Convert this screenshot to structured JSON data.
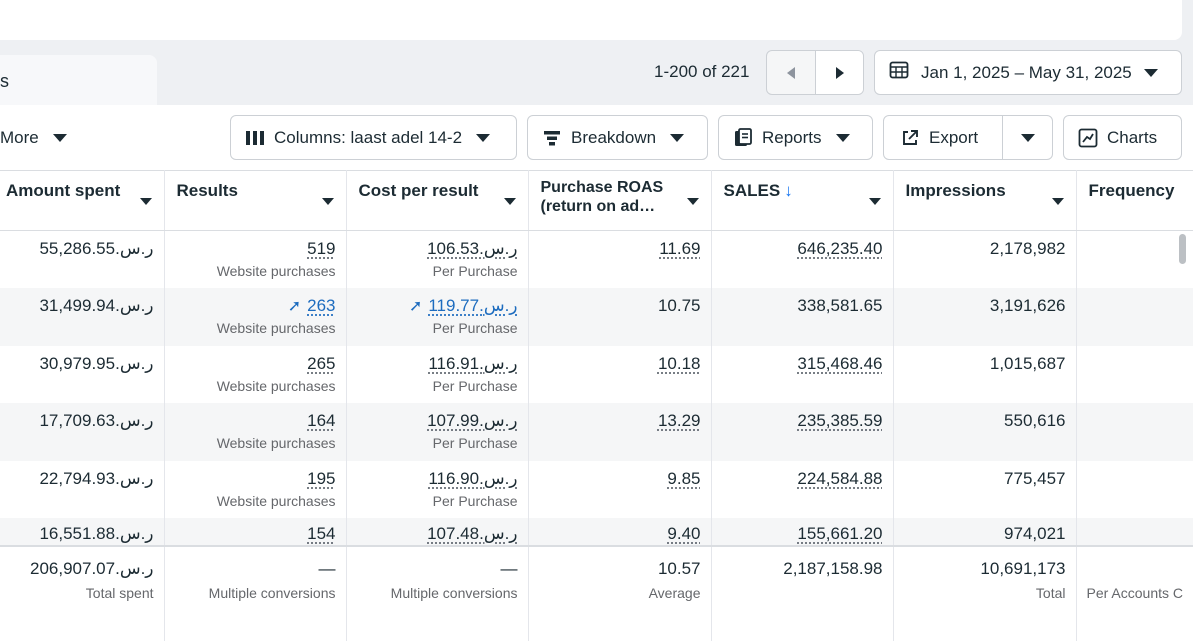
{
  "tab_label": "s",
  "pagination": {
    "text": "1-200 of 221"
  },
  "date_range": {
    "label": "Jan 1, 2025 – May 31, 2025"
  },
  "toolbar": {
    "more_label": "More",
    "columns_label": "Columns: laast adel 14-2",
    "breakdown_label": "Breakdown",
    "reports_label": "Reports",
    "export_label": "Export",
    "charts_label": "Charts"
  },
  "table": {
    "headers": {
      "amount_spent": "Amount spent",
      "results": "Results",
      "cost_per_result": "Cost per result",
      "roas_line1": "Purchase ROAS",
      "roas_line2": "(return on ad…",
      "sales": "SALES",
      "sales_sort": "↓",
      "impressions": "Impressions",
      "frequency": "Frequency"
    },
    "rows": [
      {
        "amount": "55,286.55.ر.س",
        "results": "519",
        "results_sub": "Website purchases",
        "cpr": "106.53.ر.س",
        "cpr_sub": "Per Purchase",
        "roas": "11.69",
        "sales": "646,235.40",
        "impressions": "2,178,982"
      },
      {
        "amount": "31,499.94.ر.س",
        "results": "263",
        "results_sub": "Website purchases",
        "cpr": "119.77.ر.س",
        "cpr_sub": "Per Purchase",
        "roas": "10.75",
        "sales": "338,581.65",
        "impressions": "3,191,626"
      },
      {
        "amount": "30,979.95.ر.س",
        "results": "265",
        "results_sub": "Website purchases",
        "cpr": "116.91.ر.س",
        "cpr_sub": "Per Purchase",
        "roas": "10.18",
        "sales": "315,468.46",
        "impressions": "1,015,687"
      },
      {
        "amount": "17,709.63.ر.س",
        "results": "164",
        "results_sub": "Website purchases",
        "cpr": "107.99.ر.س",
        "cpr_sub": "Per Purchase",
        "roas": "13.29",
        "sales": "235,385.59",
        "impressions": "550,616"
      },
      {
        "amount": "22,794.93.ر.س",
        "results": "195",
        "results_sub": "Website purchases",
        "cpr": "116.90.ر.س",
        "cpr_sub": "Per Purchase",
        "roas": "9.85",
        "sales": "224,584.88",
        "impressions": "775,457"
      },
      {
        "amount": "16,551.88.ر.س",
        "results": "154",
        "cpr": "107.48.ر.س",
        "roas": "9.40",
        "sales": "155,661.20",
        "impressions": "974,021"
      }
    ],
    "totals": {
      "amount": "206,907.07.ر.س",
      "amount_sub": "Total spent",
      "results": "—",
      "results_sub": "Multiple conversions",
      "cpr": "—",
      "cpr_sub": "Multiple conversions",
      "roas": "10.57",
      "roas_sub": "Average",
      "sales": "2,187,158.98",
      "impressions": "10,691,173",
      "impressions_sub": "Total",
      "frequency_sub": "Per Accounts C"
    }
  }
}
